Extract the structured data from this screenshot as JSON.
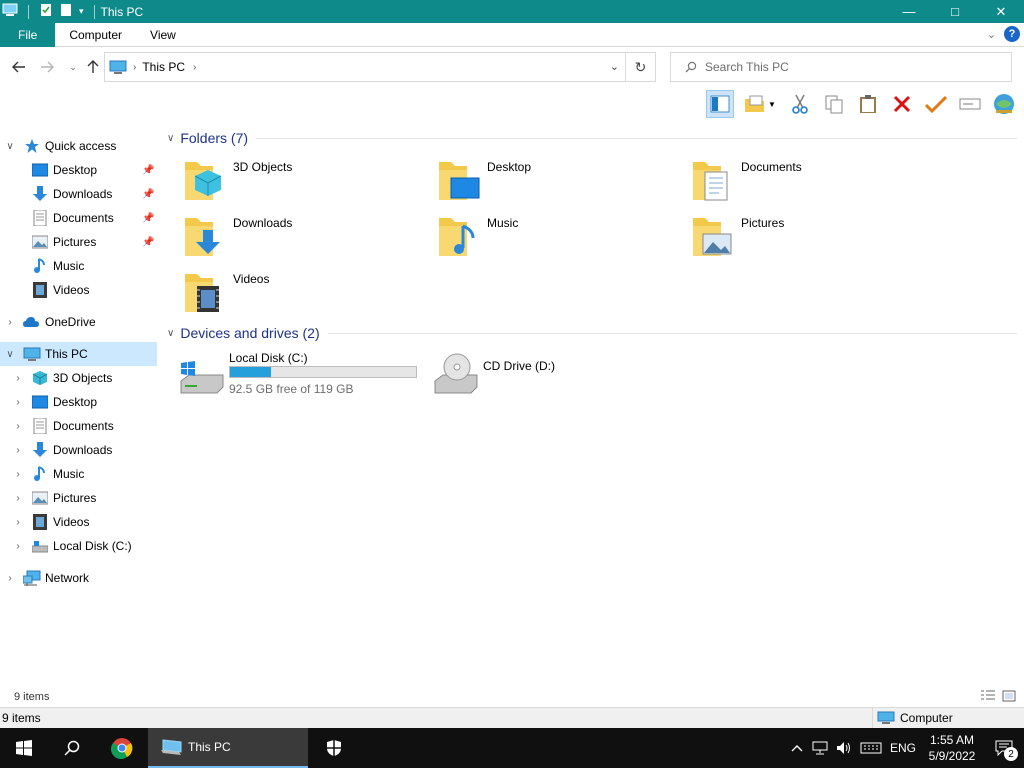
{
  "window": {
    "title": "This PC",
    "controls": {
      "minimize": "—",
      "maximize": "□",
      "close": "✕"
    }
  },
  "ribbon": {
    "tabs": [
      {
        "label": "File"
      },
      {
        "label": "Computer"
      },
      {
        "label": "View"
      }
    ],
    "help_label": "?"
  },
  "address": {
    "crumb": "This PC",
    "search_placeholder": "Search This PC"
  },
  "sidebar": {
    "quick_access": "Quick access",
    "quick_items": [
      {
        "label": "Desktop",
        "pinned": true
      },
      {
        "label": "Downloads",
        "pinned": true
      },
      {
        "label": "Documents",
        "pinned": true
      },
      {
        "label": "Pictures",
        "pinned": true
      },
      {
        "label": "Music",
        "pinned": false
      },
      {
        "label": "Videos",
        "pinned": false
      }
    ],
    "onedrive": "OneDrive",
    "this_pc": "This PC",
    "pc_items": [
      "3D Objects",
      "Desktop",
      "Documents",
      "Downloads",
      "Music",
      "Pictures",
      "Videos",
      "Local Disk (C:)"
    ],
    "network": "Network"
  },
  "content": {
    "folders_header": "Folders (7)",
    "folders": [
      "3D Objects",
      "Desktop",
      "Documents",
      "Downloads",
      "Music",
      "Pictures",
      "Videos"
    ],
    "drives_header": "Devices and drives (2)",
    "drives": [
      {
        "label": "Local Disk (C:)",
        "free_text": "92.5 GB free of 119 GB",
        "used_fraction": 0.223
      },
      {
        "label": "CD Drive (D:)"
      }
    ]
  },
  "status": {
    "item_count": "9 items",
    "detail_count": "9 items",
    "detail_location": "Computer"
  },
  "taskbar": {
    "app_label": "This PC",
    "language": "ENG",
    "time": "1:55 AM",
    "date": "5/9/2022",
    "notification_count": "2"
  },
  "colors": {
    "accent": "#0f8a8a",
    "selection": "#cce8ff",
    "group_header": "#1e3287",
    "drive_bar": "#26a0da"
  }
}
